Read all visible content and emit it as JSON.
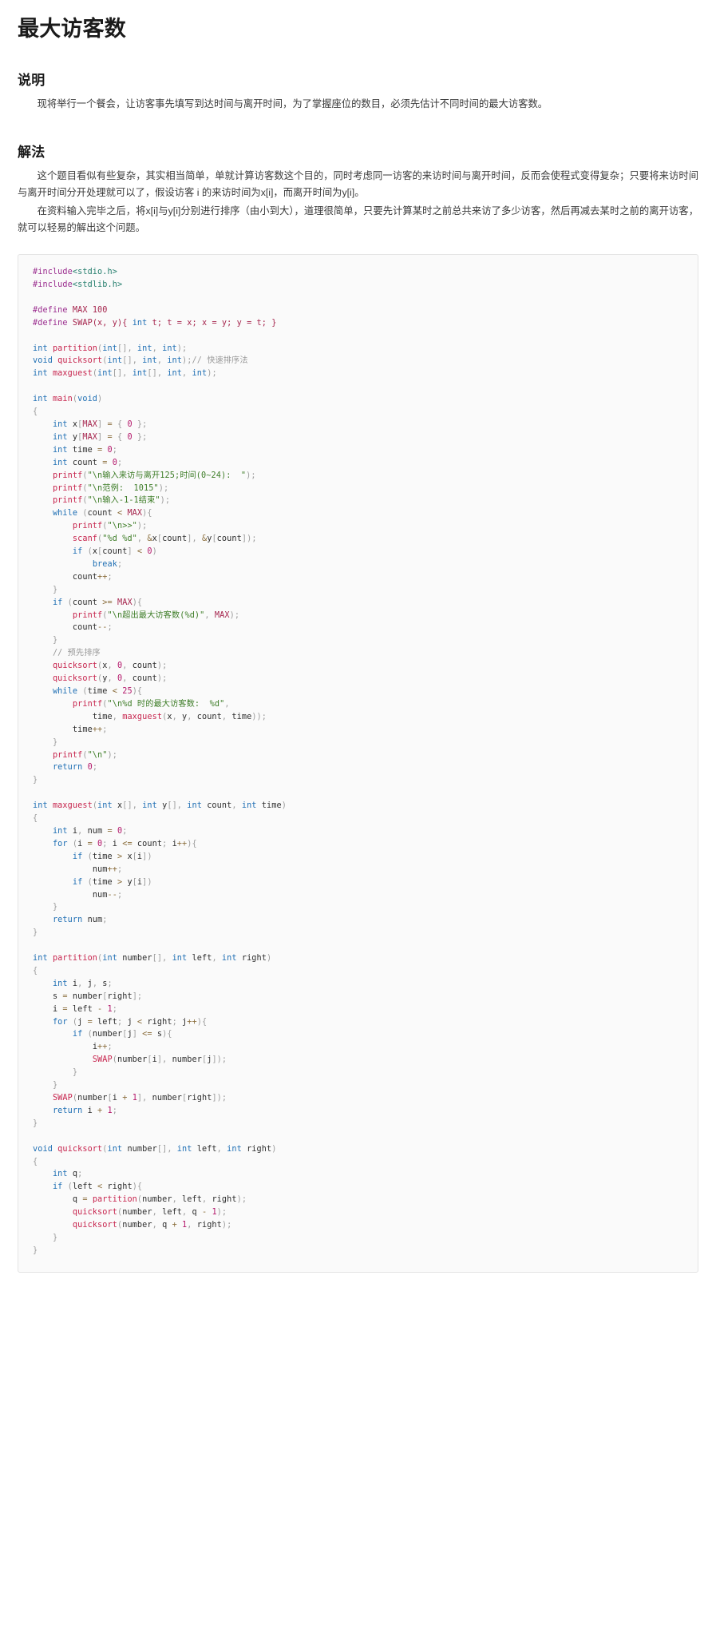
{
  "page": {
    "title": "最大访客数"
  },
  "sections": [
    {
      "heading": "说明",
      "paragraphs": [
        "现将举行一个餐会，让访客事先填写到达时间与离开时间，为了掌握座位的数目，必须先估计不同时间的最大访客数。"
      ]
    },
    {
      "heading": "解法",
      "paragraphs": [
        "这个题目看似有些复杂，其实相当简单，单就计算访客数这个目的，同时考虑同一访客的来访时间与离开时间，反而会使程式变得复杂；只要将来访时间与离开时间分开处理就可以了，假设访客 i 的来访时间为x[i]，而离开时间为y[i]。",
        "在资料输入完毕之后，将x[i]与y[i]分别进行排序（由小到大），道理很简单，只要先计算某时之前总共来访了多少访客，然后再减去某时之前的离开访客，就可以轻易的解出这个问题。"
      ]
    }
  ],
  "code": {
    "language": "c",
    "colors": {
      "preprocessor": "#9b2d8f",
      "include": "#267f6e",
      "macro": "#a6264e",
      "keyword": "#1f6fb4",
      "function": "#c7254e",
      "string": "#3e7d28",
      "number": "#b4186b",
      "comment": "#9a9a9a",
      "punctuation": "#9c9c9c",
      "operator": "#8a6d3b",
      "background": "#fafafa",
      "border": "#e4e4e4"
    },
    "text": "#include<stdio.h>\n#include<stdlib.h>\n\n#define MAX 100\n#define SWAP(x, y){ int t; t = x; x = y; y = t; }\n\nint partition(int[], int, int);\nvoid quicksort(int[], int, int);// 快速排序法\nint maxguest(int[], int[], int, int);\n\nint main(void)\n{\n    int x[MAX] = { 0 };\n    int y[MAX] = { 0 };\n    int time = 0;\n    int count = 0;\n    printf(\"\\n输入来访与离开125;时间(0~24):  \");\n    printf(\"\\n范例:  1015\");\n    printf(\"\\n输入-1-1结束\");\n    while (count < MAX){\n        printf(\"\\n>>\");\n        scanf(\"%d %d\", &x[count], &y[count]);\n        if (x[count] < 0)\n            break;\n        count++;\n    }\n    if (count >= MAX){\n        printf(\"\\n超出最大访客数(%d)\", MAX);\n        count--;\n    }\n    // 预先排序\n    quicksort(x, 0, count);\n    quicksort(y, 0, count);\n    while (time < 25){\n        printf(\"\\n%d 时的最大访客数:  %d\",\n            time, maxguest(x, y, count, time));\n        time++;\n    }\n    printf(\"\\n\");\n    return 0;\n}\n\nint maxguest(int x[], int y[], int count, int time)\n{\n    int i, num = 0;\n    for (i = 0; i <= count; i++){\n        if (time > x[i])\n            num++;\n        if (time > y[i])\n            num--;\n    }\n    return num;\n}\n\nint partition(int number[], int left, int right)\n{\n    int i, j, s;\n    s = number[right];\n    i = left - 1;\n    for (j = left; j < right; j++){\n        if (number[j] <= s){\n            i++;\n            SWAP(number[i], number[j]);\n        }\n    }\n    SWAP(number[i + 1], number[right]);\n    return i + 1;\n}\n\nvoid quicksort(int number[], int left, int right)\n{\n    int q;\n    if (left < right){\n        q = partition(number, left, right);\n        quicksort(number, left, q - 1);\n        quicksort(number, q + 1, right);\n    }\n}"
  }
}
